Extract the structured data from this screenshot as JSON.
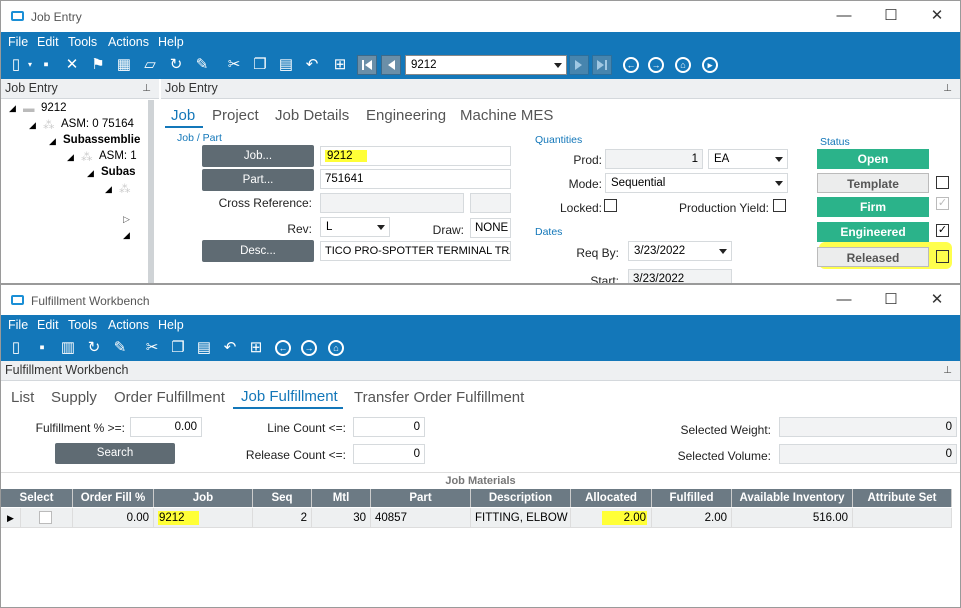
{
  "job_entry": {
    "title": "Job Entry",
    "window_controls": {
      "minimize": "—",
      "maximize": "☐",
      "close": "✕"
    },
    "menu": [
      "File",
      "Edit",
      "Tools",
      "Actions",
      "Help"
    ],
    "nav_value": "9212",
    "tree": {
      "header": "Job Entry",
      "items": [
        "9212",
        "ASM: 0 75164",
        "Subassemblie",
        "ASM: 1",
        "Subas"
      ]
    },
    "panel_header": "Job Entry",
    "tabs": [
      "Job",
      "Project",
      "Job Details",
      "Engineering",
      "Machine MES"
    ],
    "job_part": {
      "section": "Job / Part",
      "job_btn": "Job...",
      "job_value": "9212",
      "part_btn": "Part...",
      "part_value": "751641",
      "cross_ref_label": "Cross Reference:",
      "rev_label": "Rev:",
      "rev_value": "L",
      "draw_label": "Draw:",
      "draw_value": "NONE",
      "desc_btn": "Desc...",
      "desc_value": "TICO  PRO-SPOTTER  TERMINAL TRA"
    },
    "quantities": {
      "section": "Quantities",
      "prod_label": "Prod:",
      "prod_value": "1",
      "uom": "EA",
      "mode_label": "Mode:",
      "mode_value": "Sequential",
      "locked_label": "Locked:",
      "prod_yield_label": "Production Yield:"
    },
    "dates": {
      "section": "Dates",
      "req_by_label": "Req By:",
      "req_by_value": "3/23/2022",
      "start_label": "Start:",
      "start_value": "3/23/2022"
    },
    "status": {
      "section": "Status",
      "open": "Open",
      "template": "Template",
      "firm": "Firm",
      "engineered": "Engineered",
      "released": "Released",
      "colors": {
        "green": "#2bb38a",
        "gray_bg": "#eceded"
      }
    }
  },
  "fulfillment": {
    "title": "Fulfillment Workbench",
    "window_controls": {
      "minimize": "—",
      "maximize": "☐",
      "close": "✕"
    },
    "menu": [
      "File",
      "Edit",
      "Tools",
      "Actions",
      "Help"
    ],
    "panel_header": "Fulfillment Workbench",
    "tabs": [
      "List",
      "Supply",
      "Order Fulfillment",
      "Job Fulfillment",
      "Transfer Order Fulfillment"
    ],
    "filters": {
      "fulfill_label": "Fulfillment % >=:",
      "fulfill_value": "0.00",
      "line_count_label": "Line Count <=:",
      "line_count_value": "0",
      "release_count_label": "Release Count <=:",
      "release_count_value": "0",
      "search_btn": "Search",
      "weight_label": "Selected Weight:",
      "weight_value": "0",
      "volume_label": "Selected Volume:",
      "volume_value": "0"
    },
    "grid_title": "Job Materials",
    "columns": [
      "Select",
      "Order Fill %",
      "Job",
      "Seq",
      "Mtl",
      "Part",
      "Description",
      "Allocated",
      "Fulfilled",
      "Available Inventory",
      "Attribute Set"
    ],
    "row": {
      "order_fill": "0.00",
      "job": "9212",
      "seq": "2",
      "mtl": "30",
      "part": "40857",
      "description": "FITTING, ELBOW",
      "allocated": "2.00",
      "fulfilled": "2.00",
      "available": "516.00",
      "attribute_set": ""
    }
  }
}
